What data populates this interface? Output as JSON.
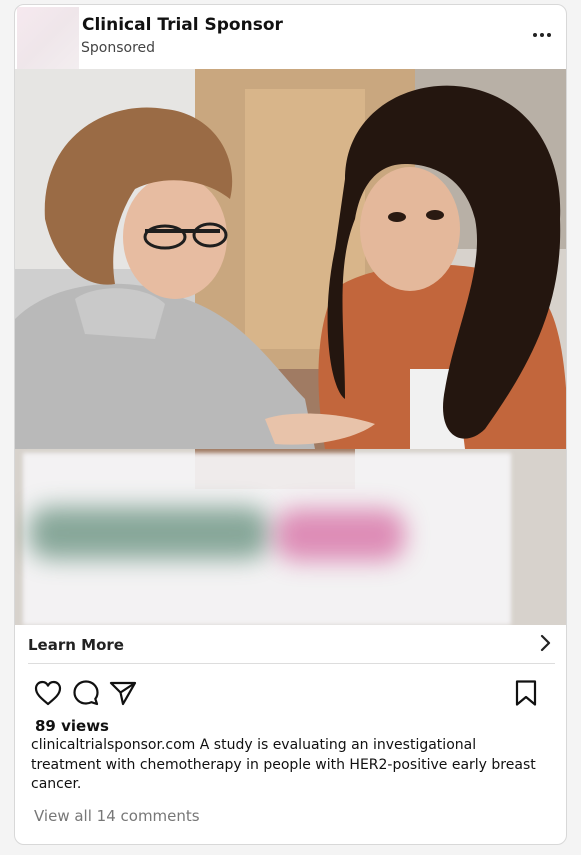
{
  "post": {
    "brand_name": "Clinical Trial Sponsor",
    "sponsored_label": "Sponsored",
    "cta_label": "Learn More",
    "views": "89 views",
    "caption": "clinicaltrialsponsor.com A study is evaluating an investigational treatment with chemotherapy in people with HER2-positive early breast cancer.",
    "comments_link": "View all 14 comments"
  },
  "icons": {
    "more": "more-options-icon",
    "chevron": "chevron-right-icon",
    "like": "heart-icon",
    "comment": "comment-icon",
    "share": "send-icon",
    "save": "bookmark-icon"
  },
  "colors": {
    "blur_green": "#2f6a50",
    "blur_pink": "#c8287a"
  }
}
